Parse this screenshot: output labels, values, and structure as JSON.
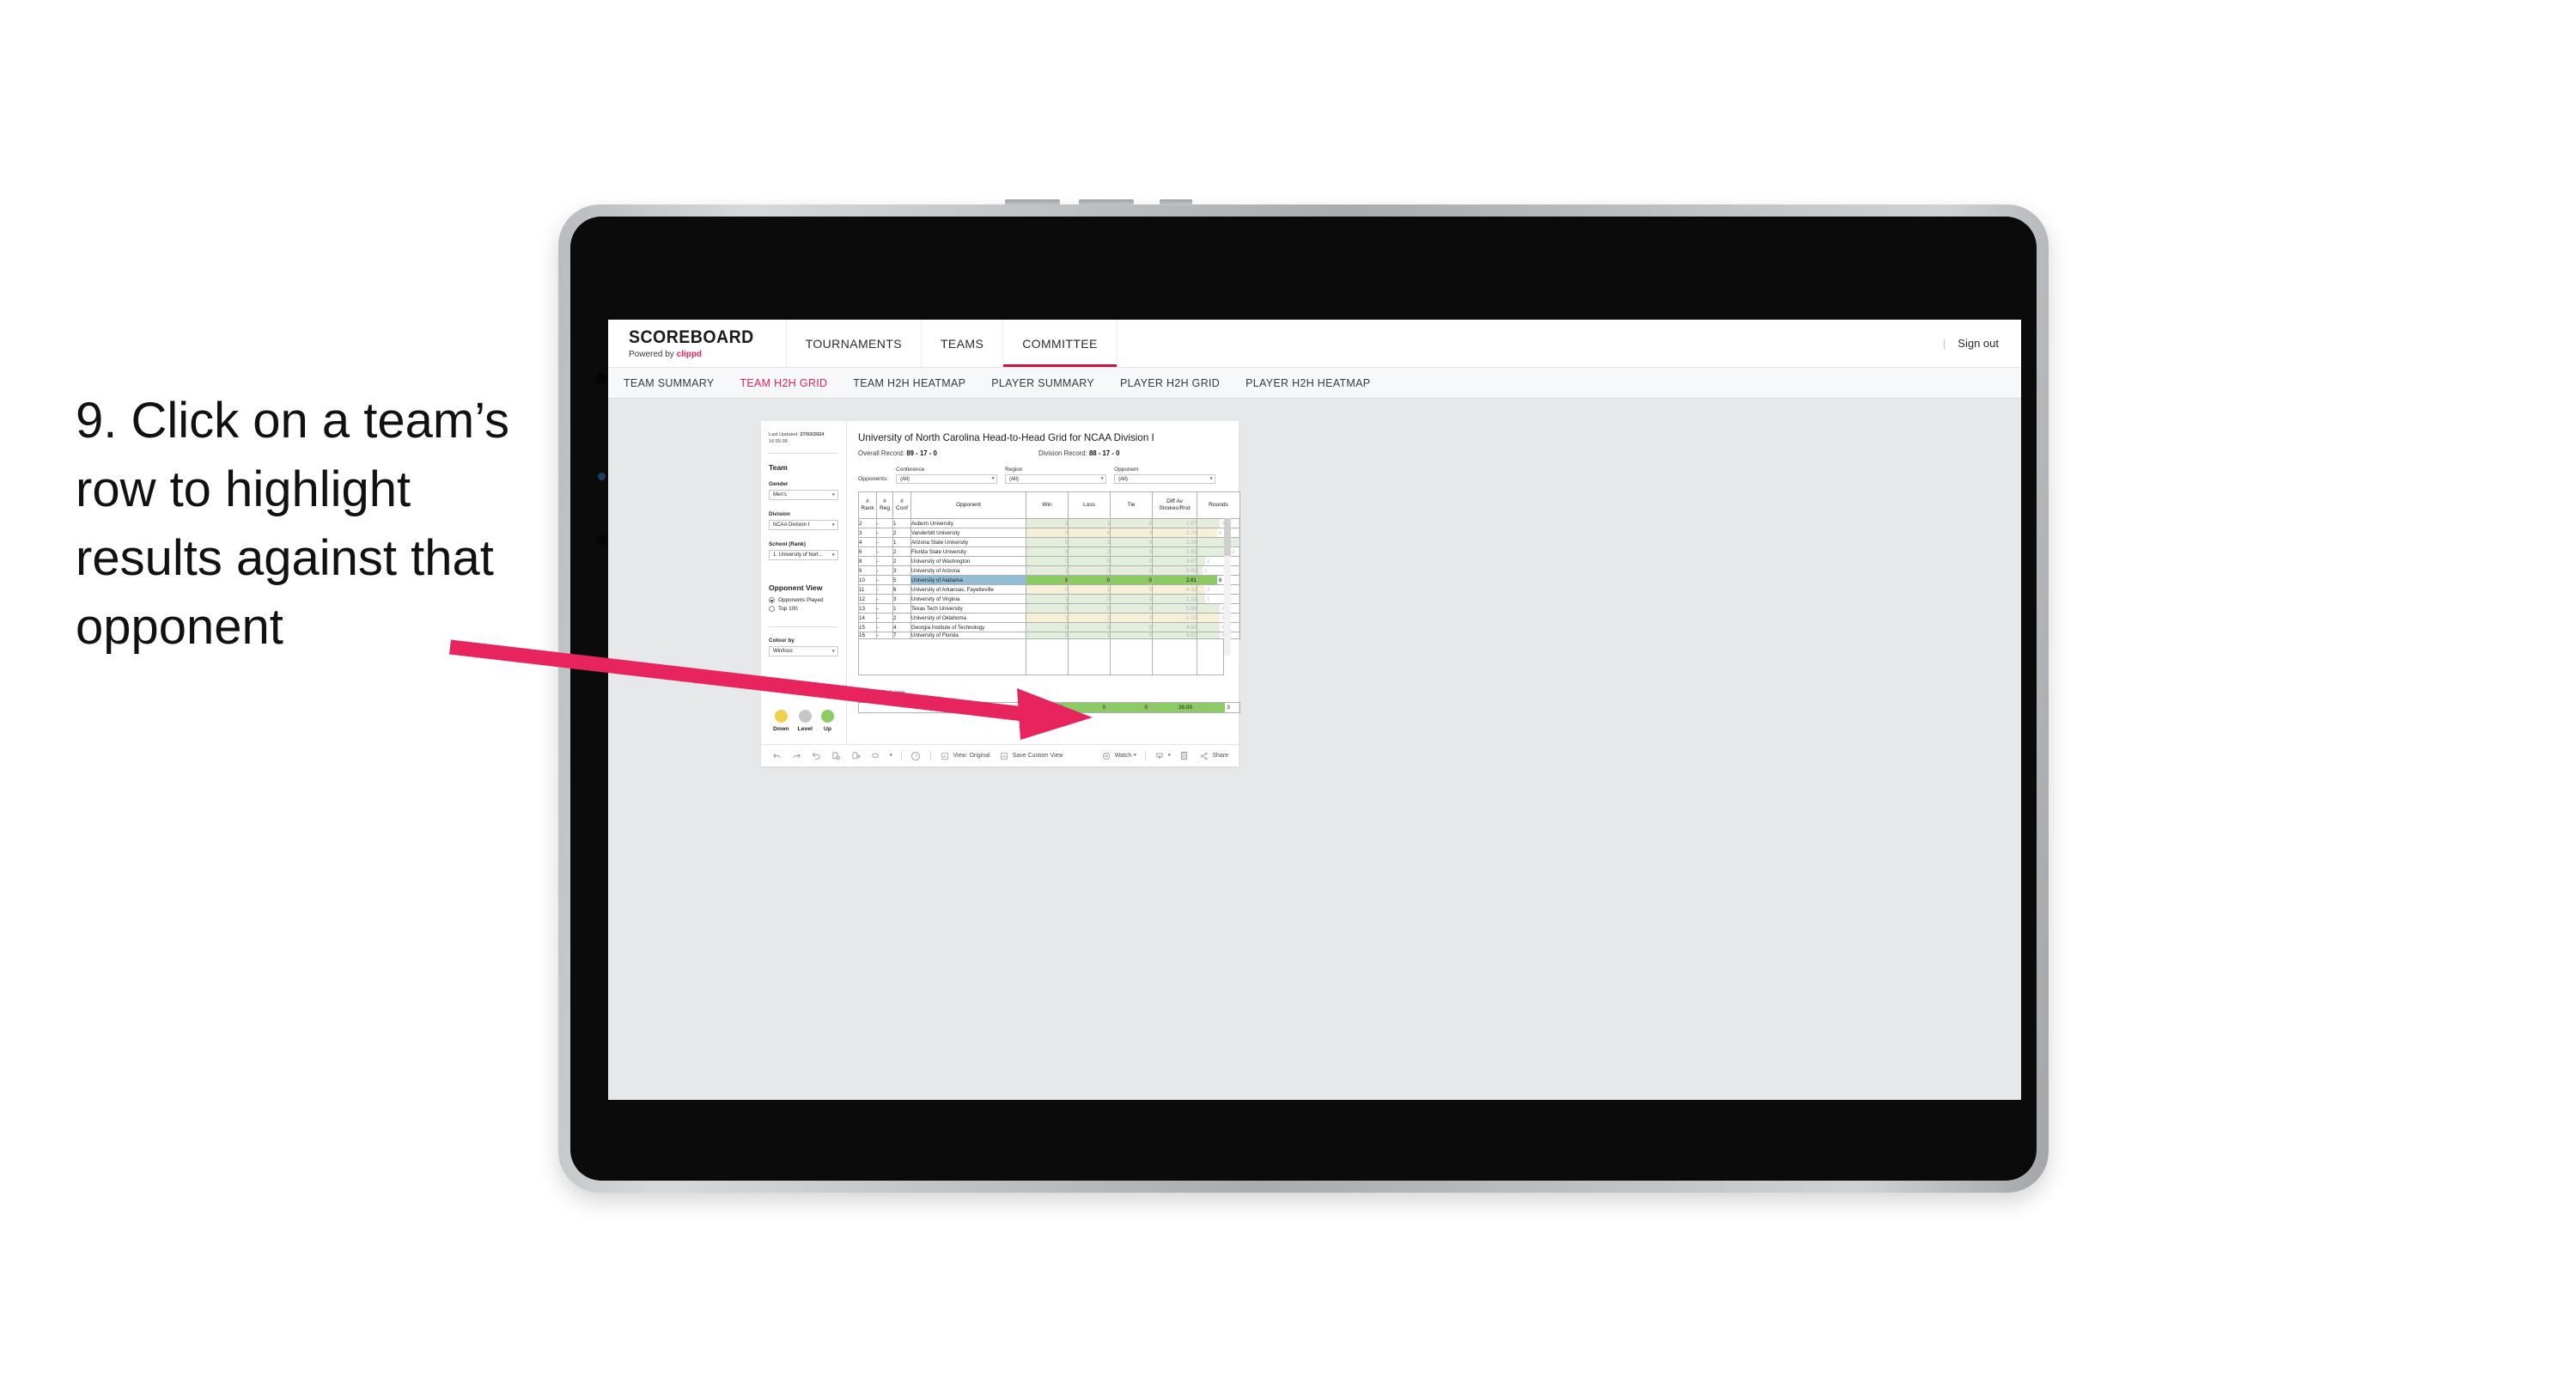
{
  "annotation": {
    "text": "9. Click on a team’s row to highlight results against that opponent",
    "arrow_color": "#e8245e"
  },
  "app": {
    "brand_title": "SCOREBOARD",
    "brand_sub_prefix": "Powered by ",
    "brand_sub_name": "clippd",
    "accent_color": "#e8225a",
    "sign_out": "Sign out",
    "divider": "|",
    "top_nav": [
      {
        "label": "TOURNAMENTS",
        "active": false
      },
      {
        "label": "TEAMS",
        "active": false
      },
      {
        "label": "COMMITTEE",
        "active": true
      }
    ],
    "sub_nav": [
      {
        "label": "TEAM SUMMARY",
        "active": false
      },
      {
        "label": "TEAM H2H GRID",
        "active": true
      },
      {
        "label": "TEAM H2H HEATMAP",
        "active": false
      },
      {
        "label": "PLAYER SUMMARY",
        "active": false
      },
      {
        "label": "PLAYER H2H GRID",
        "active": false
      },
      {
        "label": "PLAYER H2H HEATMAP",
        "active": false
      }
    ]
  },
  "sidebar": {
    "last_updated_label": "Last Updated:",
    "last_updated_date": "27/03/2024",
    "last_updated_time": "16:55:38",
    "team_heading": "Team",
    "gender_label": "Gender",
    "gender_value": "Men’s",
    "division_label": "Division",
    "division_value": "NCAA Division I",
    "school_label": "School (Rank)",
    "school_value": "1. University of Nort...",
    "opponent_view_heading": "Opponent View",
    "opponent_view_options": [
      {
        "label": "Opponents Played",
        "selected": true
      },
      {
        "label": "Top 100",
        "selected": false
      }
    ],
    "colour_by_label": "Colour by",
    "colour_by_value": "Win/loss",
    "legend": [
      {
        "label": "Down",
        "color": "#f2cf4a"
      },
      {
        "label": "Level",
        "color": "#c4c6c8"
      },
      {
        "label": "Up",
        "color": "#8ccb63"
      }
    ]
  },
  "main": {
    "title": "University of North Carolina Head-to-Head Grid for NCAA Division I",
    "overall_record_label": "Overall Record:",
    "overall_record_value": "89 - 17 - 0",
    "division_record_label": "Division Record:",
    "division_record_value": "88 - 17 - 0",
    "filters_label": "Opponents:",
    "filters": [
      {
        "label": "Conference",
        "value": "(All)"
      },
      {
        "label": "Region",
        "value": "(All)"
      },
      {
        "label": "Opponent",
        "value": "(All)"
      }
    ],
    "out_of_division_title": "Out of division"
  },
  "chart_data": {
    "type": "table",
    "title": "University of North Carolina Head-to-Head Grid for NCAA Division I",
    "columns": [
      "# Rank",
      "# Reg",
      "# Conf",
      "Opponent",
      "Win",
      "Loss",
      "Tie",
      "Diff Av Strokes/Rnd",
      "Rounds"
    ],
    "rounds_max": 17,
    "row_colors": {
      "up": "#e3eedd",
      "down": "#f7f0d9",
      "up_strong": "#8ccb63",
      "down_strong": "#f2cf4a",
      "selected_label": "#93bdd6"
    },
    "rows": [
      {
        "rank": "2",
        "reg": "-",
        "conf": "1",
        "opponent": "Auburn University",
        "win": "2",
        "loss": "1",
        "tie": "0",
        "diff": "1.67",
        "rounds": "9",
        "trend": "up",
        "selected": false
      },
      {
        "rank": "3",
        "reg": "-",
        "conf": "2",
        "opponent": "Vanderbilt University",
        "win": "0",
        "loss": "4",
        "tie": "0",
        "diff": "-2.29",
        "rounds": "8",
        "trend": "down",
        "selected": false
      },
      {
        "rank": "4",
        "reg": "-",
        "conf": "1",
        "opponent": "Arizona State University",
        "win": "5",
        "loss": "1",
        "tie": "0",
        "diff": "2.28",
        "rounds": "17",
        "trend": "up",
        "selected": false
      },
      {
        "rank": "6",
        "reg": "-",
        "conf": "2",
        "opponent": "Florida State University",
        "win": "4",
        "loss": "2",
        "tie": "0",
        "diff": "1.83",
        "rounds": "12",
        "trend": "up",
        "selected": false
      },
      {
        "rank": "8",
        "reg": "-",
        "conf": "2",
        "opponent": "University of Washington",
        "win": "1",
        "loss": "0",
        "tie": "0",
        "diff": "3.67",
        "rounds": "3",
        "trend": "up",
        "selected": false
      },
      {
        "rank": "9",
        "reg": "-",
        "conf": "3",
        "opponent": "University of Arizona",
        "win": "1",
        "loss": "0",
        "tie": "0",
        "diff": "9.00",
        "rounds": "2",
        "trend": "up",
        "selected": false
      },
      {
        "rank": "10",
        "reg": "-",
        "conf": "5",
        "opponent": "University of Alabama",
        "win": "3",
        "loss": "0",
        "tie": "0",
        "diff": "2.61",
        "rounds": "8",
        "trend": "up",
        "selected": true
      },
      {
        "rank": "11",
        "reg": "-",
        "conf": "6",
        "opponent": "University of Arkansas, Fayetteville",
        "win": "0",
        "loss": "1",
        "tie": "0",
        "diff": "-4.33",
        "rounds": "3",
        "trend": "down",
        "selected": false
      },
      {
        "rank": "12",
        "reg": "-",
        "conf": "3",
        "opponent": "University of Virginia",
        "win": "1",
        "loss": "0",
        "tie": "0",
        "diff": "2.33",
        "rounds": "3",
        "trend": "up",
        "selected": false
      },
      {
        "rank": "13",
        "reg": "-",
        "conf": "1",
        "opponent": "Texas Tech University",
        "win": "3",
        "loss": "0",
        "tie": "0",
        "diff": "5.56",
        "rounds": "9",
        "trend": "up",
        "selected": false
      },
      {
        "rank": "14",
        "reg": "-",
        "conf": "2",
        "opponent": "University of Oklahoma",
        "win": "1",
        "loss": "2",
        "tie": "0",
        "diff": "-1.00",
        "rounds": "9",
        "trend": "down",
        "selected": false
      },
      {
        "rank": "15",
        "reg": "-",
        "conf": "4",
        "opponent": "Georgia Institute of Technology",
        "win": "5",
        "loss": "0",
        "tie": "0",
        "diff": "4.50",
        "rounds": "9",
        "trend": "up",
        "selected": false
      },
      {
        "rank": "16",
        "reg": "-",
        "conf": "7",
        "opponent": "University of Florida",
        "win": "3",
        "loss": "1",
        "tie": "0",
        "diff": "6.62",
        "rounds": "9",
        "trend": "up",
        "selected": false
      }
    ],
    "out_of_division": {
      "label": "NCAA Division II",
      "win": "1",
      "loss": "0",
      "tie": "0",
      "diff": "26.00",
      "rounds": "3",
      "color": "#8ccb63"
    }
  },
  "toolbar": {
    "icons": [
      "undo-icon",
      "redo-icon",
      "revert-icon",
      "refresh-icon",
      "pause-icon",
      "custom-views-icon",
      "ask-data-icon"
    ],
    "view_label": "View: Original",
    "save_custom_view_label": "Save Custom View",
    "watch_label": "Watch",
    "share_label": "Share"
  }
}
